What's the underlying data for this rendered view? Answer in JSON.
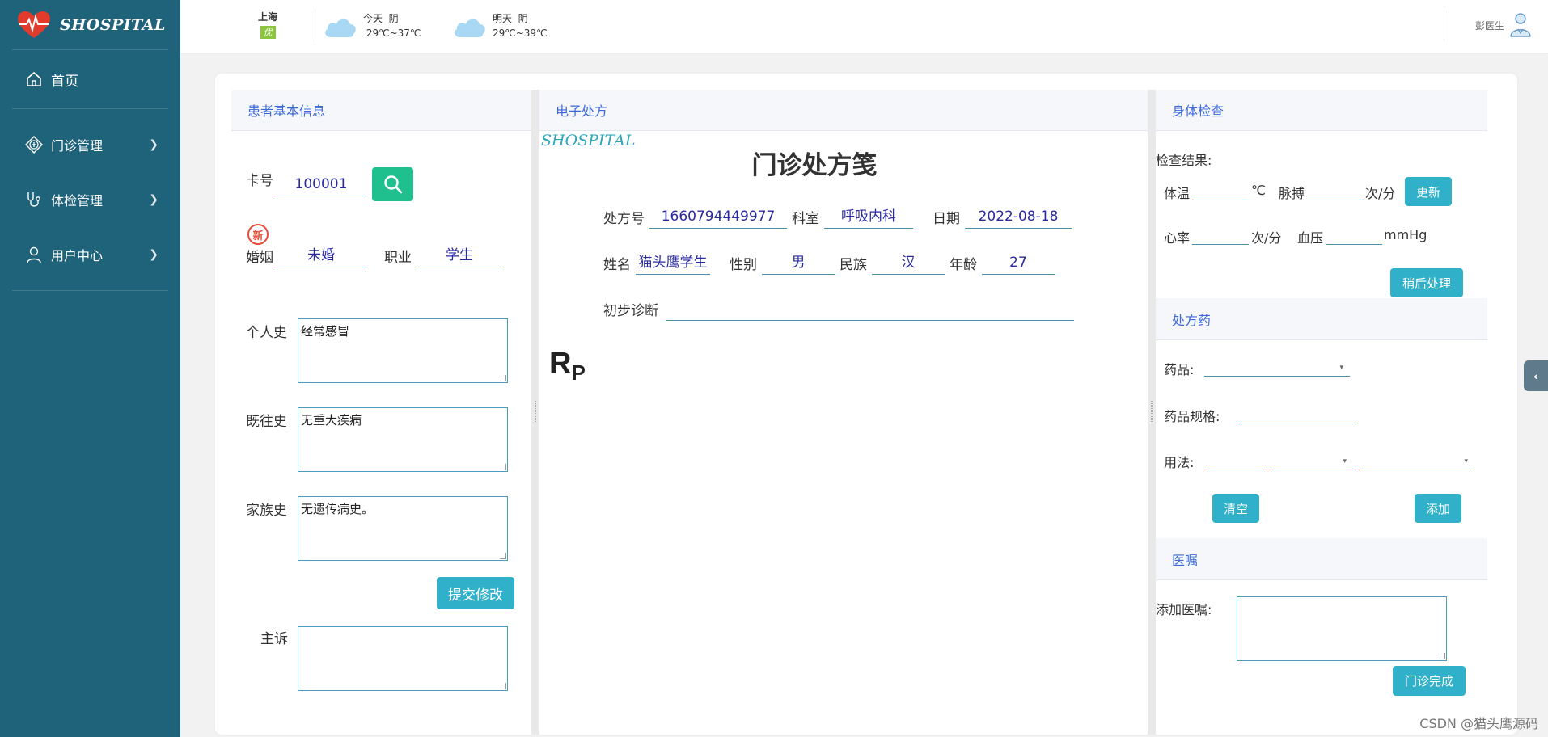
{
  "app": {
    "logo_text": "SHOSPITAL"
  },
  "sidebar": {
    "home": "首页",
    "items": [
      {
        "label": "门诊管理",
        "icon": "diamond-plus-icon"
      },
      {
        "label": "体检管理",
        "icon": "stethoscope-icon"
      },
      {
        "label": "用户中心",
        "icon": "user-icon"
      }
    ]
  },
  "header": {
    "city": "上海",
    "aqi": "优",
    "today": {
      "label": "今天",
      "condition": "阴",
      "temp": "29℃~37℃"
    },
    "tomorrow": {
      "label": "明天",
      "condition": "阴",
      "temp": "29℃~39℃"
    },
    "user_name": "彭医生"
  },
  "left": {
    "title": "患者基本信息",
    "card_label": "卡号",
    "card_no": "100001",
    "new_badge": "新",
    "marriage_label": "婚姻",
    "marriage": "未婚",
    "job_label": "职业",
    "job": "学生",
    "personal_label": "个人史",
    "personal": "经常感冒",
    "past_label": "既往史",
    "past": "无重大疾病",
    "family_label": "家族史",
    "family": "无遗传病史。",
    "submit": "提交修改",
    "complaint_label": "主诉",
    "complaint": ""
  },
  "mid": {
    "title": "电子处方",
    "brand": "SHOSPITAL",
    "doc_title": "门诊处方笺",
    "rx_no_label": "处方号",
    "rx_no": "1660794449977",
    "dept_label": "科室",
    "dept": "呼吸内科",
    "date_label": "日期",
    "date": "2022-08-18",
    "name_label": "姓名",
    "name": "猫头鹰学生",
    "gender_label": "性别",
    "gender": "男",
    "ethnic_label": "民族",
    "ethnic": "汉",
    "age_label": "年龄",
    "age": "27",
    "diag_label": "初步诊断",
    "diag": "",
    "rp_main": "R",
    "rp_sub": "P"
  },
  "right": {
    "exam_title": "身体检查",
    "result_label": "检查结果:",
    "temp_label": "体温",
    "temp_unit": "℃",
    "pulse_label": "脉搏",
    "pulse_unit": "次/分",
    "update": "更新",
    "hr_label": "心率",
    "hr_unit": "次/分",
    "bp_label": "血压",
    "bp_unit": "mmHg",
    "later": "稍后处理",
    "drug_title": "处方药",
    "drug_label": "药品:",
    "spec_label": "药品规格:",
    "usage_label": "用法:",
    "clear": "清空",
    "add": "添加",
    "advice_title": "医嘱",
    "advice_label": "添加医嘱:",
    "finish": "门诊完成"
  },
  "watermark": "CSDN @猫头鹰源码"
}
